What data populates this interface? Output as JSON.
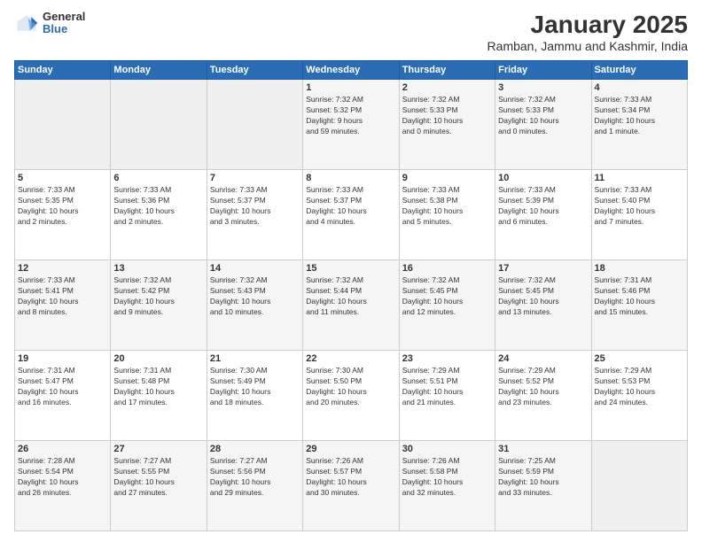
{
  "logo": {
    "general": "General",
    "blue": "Blue"
  },
  "header": {
    "title": "January 2025",
    "location": "Ramban, Jammu and Kashmir, India"
  },
  "weekdays": [
    "Sunday",
    "Monday",
    "Tuesday",
    "Wednesday",
    "Thursday",
    "Friday",
    "Saturday"
  ],
  "weeks": [
    [
      {
        "day": "",
        "info": ""
      },
      {
        "day": "",
        "info": ""
      },
      {
        "day": "",
        "info": ""
      },
      {
        "day": "1",
        "info": "Sunrise: 7:32 AM\nSunset: 5:32 PM\nDaylight: 9 hours\nand 59 minutes."
      },
      {
        "day": "2",
        "info": "Sunrise: 7:32 AM\nSunset: 5:33 PM\nDaylight: 10 hours\nand 0 minutes."
      },
      {
        "day": "3",
        "info": "Sunrise: 7:32 AM\nSunset: 5:33 PM\nDaylight: 10 hours\nand 0 minutes."
      },
      {
        "day": "4",
        "info": "Sunrise: 7:33 AM\nSunset: 5:34 PM\nDaylight: 10 hours\nand 1 minute."
      }
    ],
    [
      {
        "day": "5",
        "info": "Sunrise: 7:33 AM\nSunset: 5:35 PM\nDaylight: 10 hours\nand 2 minutes."
      },
      {
        "day": "6",
        "info": "Sunrise: 7:33 AM\nSunset: 5:36 PM\nDaylight: 10 hours\nand 2 minutes."
      },
      {
        "day": "7",
        "info": "Sunrise: 7:33 AM\nSunset: 5:37 PM\nDaylight: 10 hours\nand 3 minutes."
      },
      {
        "day": "8",
        "info": "Sunrise: 7:33 AM\nSunset: 5:37 PM\nDaylight: 10 hours\nand 4 minutes."
      },
      {
        "day": "9",
        "info": "Sunrise: 7:33 AM\nSunset: 5:38 PM\nDaylight: 10 hours\nand 5 minutes."
      },
      {
        "day": "10",
        "info": "Sunrise: 7:33 AM\nSunset: 5:39 PM\nDaylight: 10 hours\nand 6 minutes."
      },
      {
        "day": "11",
        "info": "Sunrise: 7:33 AM\nSunset: 5:40 PM\nDaylight: 10 hours\nand 7 minutes."
      }
    ],
    [
      {
        "day": "12",
        "info": "Sunrise: 7:33 AM\nSunset: 5:41 PM\nDaylight: 10 hours\nand 8 minutes."
      },
      {
        "day": "13",
        "info": "Sunrise: 7:32 AM\nSunset: 5:42 PM\nDaylight: 10 hours\nand 9 minutes."
      },
      {
        "day": "14",
        "info": "Sunrise: 7:32 AM\nSunset: 5:43 PM\nDaylight: 10 hours\nand 10 minutes."
      },
      {
        "day": "15",
        "info": "Sunrise: 7:32 AM\nSunset: 5:44 PM\nDaylight: 10 hours\nand 11 minutes."
      },
      {
        "day": "16",
        "info": "Sunrise: 7:32 AM\nSunset: 5:45 PM\nDaylight: 10 hours\nand 12 minutes."
      },
      {
        "day": "17",
        "info": "Sunrise: 7:32 AM\nSunset: 5:45 PM\nDaylight: 10 hours\nand 13 minutes."
      },
      {
        "day": "18",
        "info": "Sunrise: 7:31 AM\nSunset: 5:46 PM\nDaylight: 10 hours\nand 15 minutes."
      }
    ],
    [
      {
        "day": "19",
        "info": "Sunrise: 7:31 AM\nSunset: 5:47 PM\nDaylight: 10 hours\nand 16 minutes."
      },
      {
        "day": "20",
        "info": "Sunrise: 7:31 AM\nSunset: 5:48 PM\nDaylight: 10 hours\nand 17 minutes."
      },
      {
        "day": "21",
        "info": "Sunrise: 7:30 AM\nSunset: 5:49 PM\nDaylight: 10 hours\nand 18 minutes."
      },
      {
        "day": "22",
        "info": "Sunrise: 7:30 AM\nSunset: 5:50 PM\nDaylight: 10 hours\nand 20 minutes."
      },
      {
        "day": "23",
        "info": "Sunrise: 7:29 AM\nSunset: 5:51 PM\nDaylight: 10 hours\nand 21 minutes."
      },
      {
        "day": "24",
        "info": "Sunrise: 7:29 AM\nSunset: 5:52 PM\nDaylight: 10 hours\nand 23 minutes."
      },
      {
        "day": "25",
        "info": "Sunrise: 7:29 AM\nSunset: 5:53 PM\nDaylight: 10 hours\nand 24 minutes."
      }
    ],
    [
      {
        "day": "26",
        "info": "Sunrise: 7:28 AM\nSunset: 5:54 PM\nDaylight: 10 hours\nand 26 minutes."
      },
      {
        "day": "27",
        "info": "Sunrise: 7:27 AM\nSunset: 5:55 PM\nDaylight: 10 hours\nand 27 minutes."
      },
      {
        "day": "28",
        "info": "Sunrise: 7:27 AM\nSunset: 5:56 PM\nDaylight: 10 hours\nand 29 minutes."
      },
      {
        "day": "29",
        "info": "Sunrise: 7:26 AM\nSunset: 5:57 PM\nDaylight: 10 hours\nand 30 minutes."
      },
      {
        "day": "30",
        "info": "Sunrise: 7:26 AM\nSunset: 5:58 PM\nDaylight: 10 hours\nand 32 minutes."
      },
      {
        "day": "31",
        "info": "Sunrise: 7:25 AM\nSunset: 5:59 PM\nDaylight: 10 hours\nand 33 minutes."
      },
      {
        "day": "",
        "info": ""
      }
    ]
  ]
}
